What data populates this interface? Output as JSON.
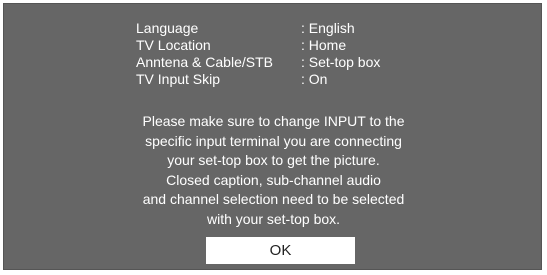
{
  "settings": {
    "rows": [
      {
        "label": "Language",
        "value": ": English"
      },
      {
        "label": "TV Location",
        "value": ": Home"
      },
      {
        "label": "Anntena & Cable/STB",
        "value": ": Set-top box"
      },
      {
        "label": "TV Input Skip",
        "value": ": On"
      }
    ]
  },
  "message": {
    "lines": [
      "Please make sure to change INPUT to the",
      "specific input terminal you are connecting",
      "your set-top box to get the picture.",
      "Closed caption, sub-channel audio",
      "and channel selection need to be selected",
      "with your set-top box."
    ]
  },
  "ok_button": {
    "label": "OK"
  },
  "colors": {
    "dialog_background": "#666666",
    "text": "#ffffff",
    "button_background": "#ffffff",
    "button_text": "#222222"
  }
}
